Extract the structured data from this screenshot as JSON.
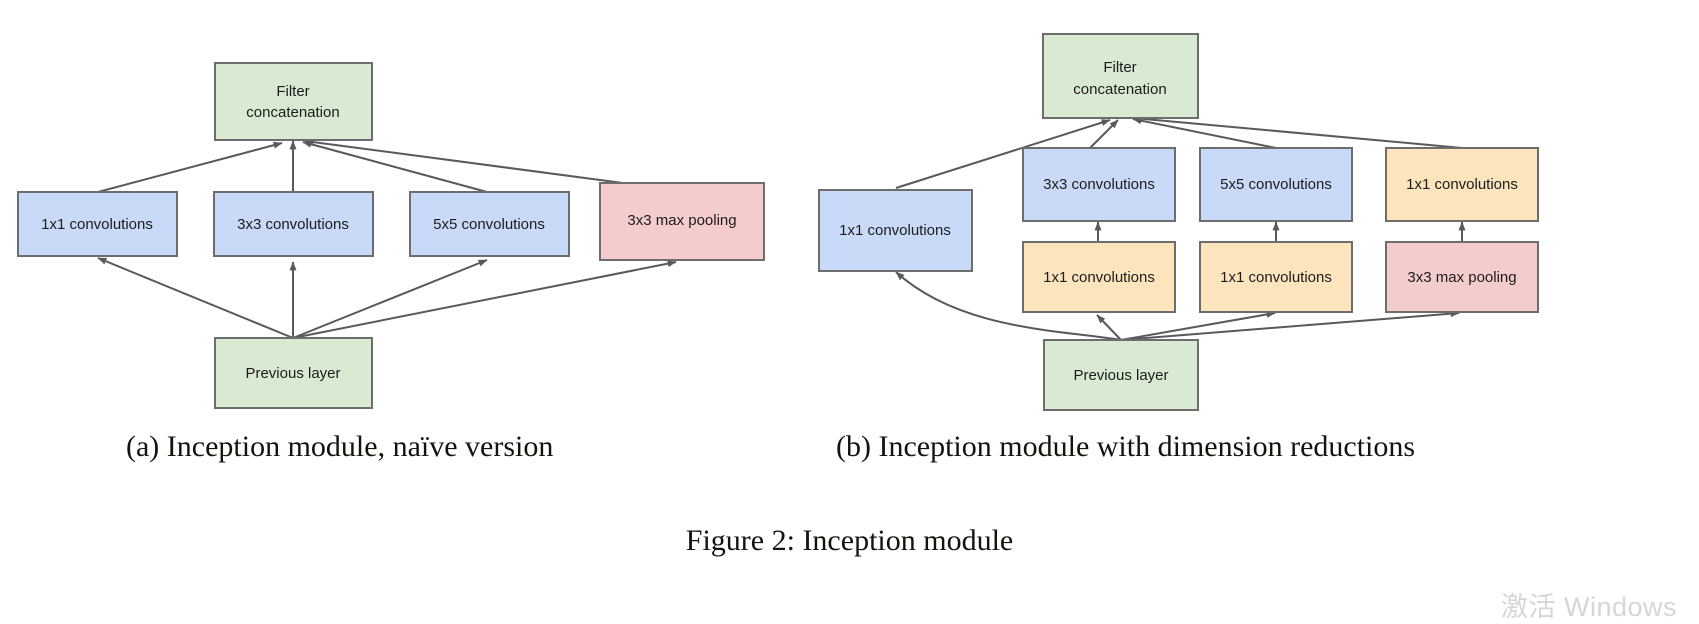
{
  "figure": {
    "caption": "Figure 2: Inception module",
    "watermark": "激活 Windows"
  },
  "colors": {
    "green_fill": "#d9ead3",
    "blue_fill": "#c9daf8",
    "pink_fill": "#f4cccc",
    "yellow_fill": "#fce5bd",
    "box_stroke": "#6d6d6d",
    "edge_stroke": "#595959",
    "text": "#1c1c1c",
    "watermark": "#d6d6d6"
  },
  "panel_a": {
    "caption": "(a)  Inception module, naïve version",
    "nodes": {
      "filter_concat": "Filter\nconcatenation",
      "filter_concat_line1": "Filter",
      "filter_concat_line2": "concatenation",
      "conv1x1": "1x1 convolutions",
      "conv3x3": "3x3 convolutions",
      "conv5x5": "5x5 convolutions",
      "maxpool3x3": "3x3 max pooling",
      "previous_layer": "Previous layer"
    },
    "edges": [
      "previous-layer -> 1x1 convolutions",
      "previous-layer -> 3x3 convolutions",
      "previous-layer -> 5x5 convolutions",
      "previous-layer -> 3x3 max pooling",
      "1x1 convolutions -> filter concatenation",
      "3x3 convolutions -> filter concatenation",
      "5x5 convolutions -> filter concatenation",
      "3x3 max pooling -> filter concatenation"
    ]
  },
  "panel_b": {
    "caption": "(b)  Inception module with dimension reductions",
    "nodes": {
      "filter_concat_line1": "Filter",
      "filter_concat_line2": "concatenation",
      "conv1x1_direct": "1x1 convolutions",
      "conv3x3": "3x3 convolutions",
      "conv5x5": "5x5 convolutions",
      "conv1x1_after_pool": "1x1 convolutions",
      "reduce1x1_a": "1x1 convolutions",
      "reduce1x1_b": "1x1 convolutions",
      "maxpool3x3": "3x3 max pooling",
      "previous_layer": "Previous layer"
    },
    "edges": [
      "previous-layer -> 1x1 convolutions (direct)",
      "previous-layer -> 1x1 convolutions (reduce a)",
      "previous-layer -> 1x1 convolutions (reduce b)",
      "previous-layer -> 3x3 max pooling",
      "1x1 convolutions (reduce a) -> 3x3 convolutions",
      "1x1 convolutions (reduce b) -> 5x5 convolutions",
      "3x3 max pooling -> 1x1 convolutions (after pool)",
      "1x1 convolutions (direct) -> filter concatenation",
      "3x3 convolutions -> filter concatenation",
      "5x5 convolutions -> filter concatenation",
      "1x1 convolutions (after pool) -> filter concatenation"
    ]
  }
}
